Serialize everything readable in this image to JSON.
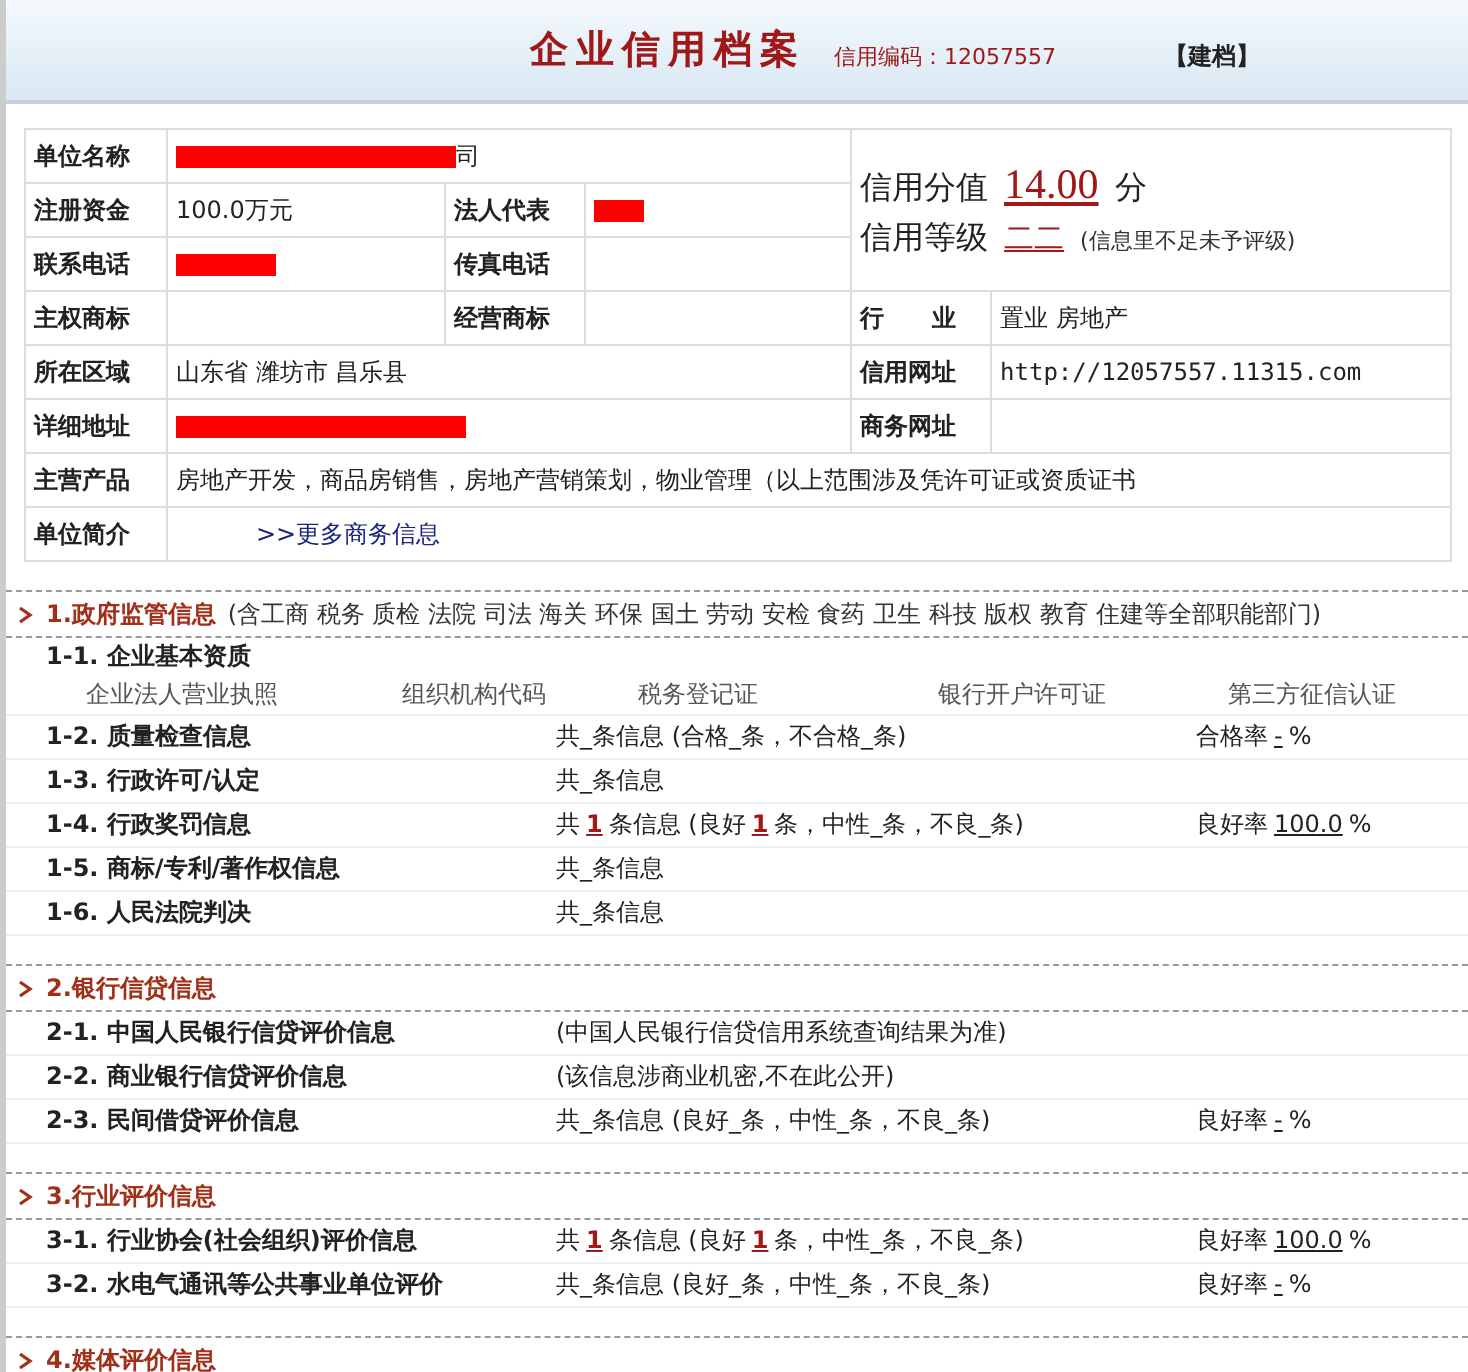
{
  "header": {
    "title": "企业信用档案",
    "code_label": "信用编码：",
    "code": "12057557",
    "action": "【建档】"
  },
  "profile": {
    "name": {
      "label": "单位名称",
      "visible_tail": "司",
      "redacted": true
    },
    "capital": {
      "label": "注册资金",
      "value": "100.0万元"
    },
    "legal_rep": {
      "label": "法人代表",
      "redacted": true
    },
    "phone": {
      "label": "联系电话",
      "redacted": true
    },
    "fax": {
      "label": "传真电话"
    },
    "main_trademark": {
      "label": "主权商标"
    },
    "business_trademark": {
      "label": "经营商标"
    },
    "industry": {
      "label": "行　　业",
      "value": "置业 房地产"
    },
    "region": {
      "label": "所在区域",
      "value": "山东省 潍坊市 昌乐县"
    },
    "credit_url": {
      "label": "信用网址",
      "value": "http://12057557.11315.com"
    },
    "address": {
      "label": "详细地址",
      "redacted": true
    },
    "business_url": {
      "label": "商务网址"
    },
    "products": {
      "label": "主营产品",
      "value": "房地产开发，商品房销售，房地产营销策划，物业管理（以上范围涉及凭许可证或资质证书"
    },
    "intro": {
      "label": "单位简介",
      "link": ">>更多商务信息"
    },
    "score": {
      "label": "信用分值",
      "value": "14.00",
      "unit": "分"
    },
    "grade": {
      "label": "信用等级",
      "value": "二二",
      "note": "(信息里不足未予评级)"
    }
  },
  "sections": [
    {
      "title": "1.政府监管信息",
      "note": "(含工商 税务 质检 法院 司法 海关 环保 国土 劳动 安检 食药 卫生 科技 版权 教育 住建等全部职能部门)",
      "items": [
        {
          "kind": "licenses",
          "label": "1-1. 企业基本资质",
          "licenses": [
            "企业法人营业执照",
            "组织机构代码",
            "税务登记证",
            "银行开户许可证",
            "第三方征信认证"
          ]
        },
        {
          "kind": "row",
          "label": "1-2. 质量检查信息",
          "middle": [
            {
              "kind": "text",
              "text": "共_条信息 (合格_条，不合格_条)"
            }
          ],
          "right": [
            {
              "kind": "text",
              "text": "合格率"
            },
            {
              "kind": "fill",
              "text": "-"
            },
            {
              "kind": "text",
              "text": "%"
            }
          ]
        },
        {
          "kind": "row",
          "label": "1-3. 行政许可/认定",
          "middle": [
            {
              "kind": "text",
              "text": "共_条信息"
            }
          ]
        },
        {
          "kind": "row",
          "label": "1-4. 行政奖罚信息",
          "middle": [
            {
              "kind": "text",
              "text": "共"
            },
            {
              "kind": "count",
              "text": "1"
            },
            {
              "kind": "text",
              "text": "条信息 (良好"
            },
            {
              "kind": "count",
              "text": "1"
            },
            {
              "kind": "text",
              "text": "条，中性_条，不良_条)"
            }
          ],
          "right": [
            {
              "kind": "text",
              "text": "良好率"
            },
            {
              "kind": "fill",
              "text": "100.0"
            },
            {
              "kind": "text",
              "text": "%"
            }
          ]
        },
        {
          "kind": "row",
          "label": "1-5. 商标/专利/著作权信息",
          "middle": [
            {
              "kind": "text",
              "text": "共_条信息"
            }
          ]
        },
        {
          "kind": "row",
          "label": "1-6. 人民法院判决",
          "middle": [
            {
              "kind": "text",
              "text": "共_条信息"
            }
          ]
        }
      ]
    },
    {
      "title": "2.银行信贷信息",
      "items": [
        {
          "kind": "row",
          "label": "2-1. 中国人民银行信贷评价信息",
          "middle": [
            {
              "kind": "text",
              "text": "(中国人民银行信贷信用系统查询结果为准)"
            }
          ]
        },
        {
          "kind": "row",
          "label": "2-2. 商业银行信贷评价信息",
          "middle": [
            {
              "kind": "text",
              "text": "(该信息涉商业机密,不在此公开)"
            }
          ]
        },
        {
          "kind": "row",
          "label": "2-3. 民间借贷评价信息",
          "middle": [
            {
              "kind": "text",
              "text": "共_条信息 (良好_条，中性_条，不良_条)"
            }
          ],
          "right": [
            {
              "kind": "text",
              "text": "良好率"
            },
            {
              "kind": "fill",
              "text": "-"
            },
            {
              "kind": "text",
              "text": "%"
            }
          ]
        }
      ]
    },
    {
      "title": "3.行业评价信息",
      "items": [
        {
          "kind": "row",
          "label": "3-1. 行业协会(社会组织)评价信息",
          "middle": [
            {
              "kind": "text",
              "text": "共"
            },
            {
              "kind": "count",
              "text": "1"
            },
            {
              "kind": "text",
              "text": "条信息 (良好"
            },
            {
              "kind": "count",
              "text": "1"
            },
            {
              "kind": "text",
              "text": "条，中性_条，不良_条)"
            }
          ],
          "right": [
            {
              "kind": "text",
              "text": "良好率"
            },
            {
              "kind": "fill",
              "text": "100.0"
            },
            {
              "kind": "text",
              "text": "%"
            }
          ]
        },
        {
          "kind": "row",
          "label": "3-2. 水电气通讯等公共事业单位评价",
          "middle": [
            {
              "kind": "text",
              "text": "共_条信息 (良好_条，中性_条，不良_条)"
            }
          ],
          "right": [
            {
              "kind": "text",
              "text": "良好率"
            },
            {
              "kind": "fill",
              "text": "-"
            },
            {
              "kind": "text",
              "text": "%"
            }
          ]
        }
      ]
    },
    {
      "title": "4.媒体评价信息"
    }
  ]
}
